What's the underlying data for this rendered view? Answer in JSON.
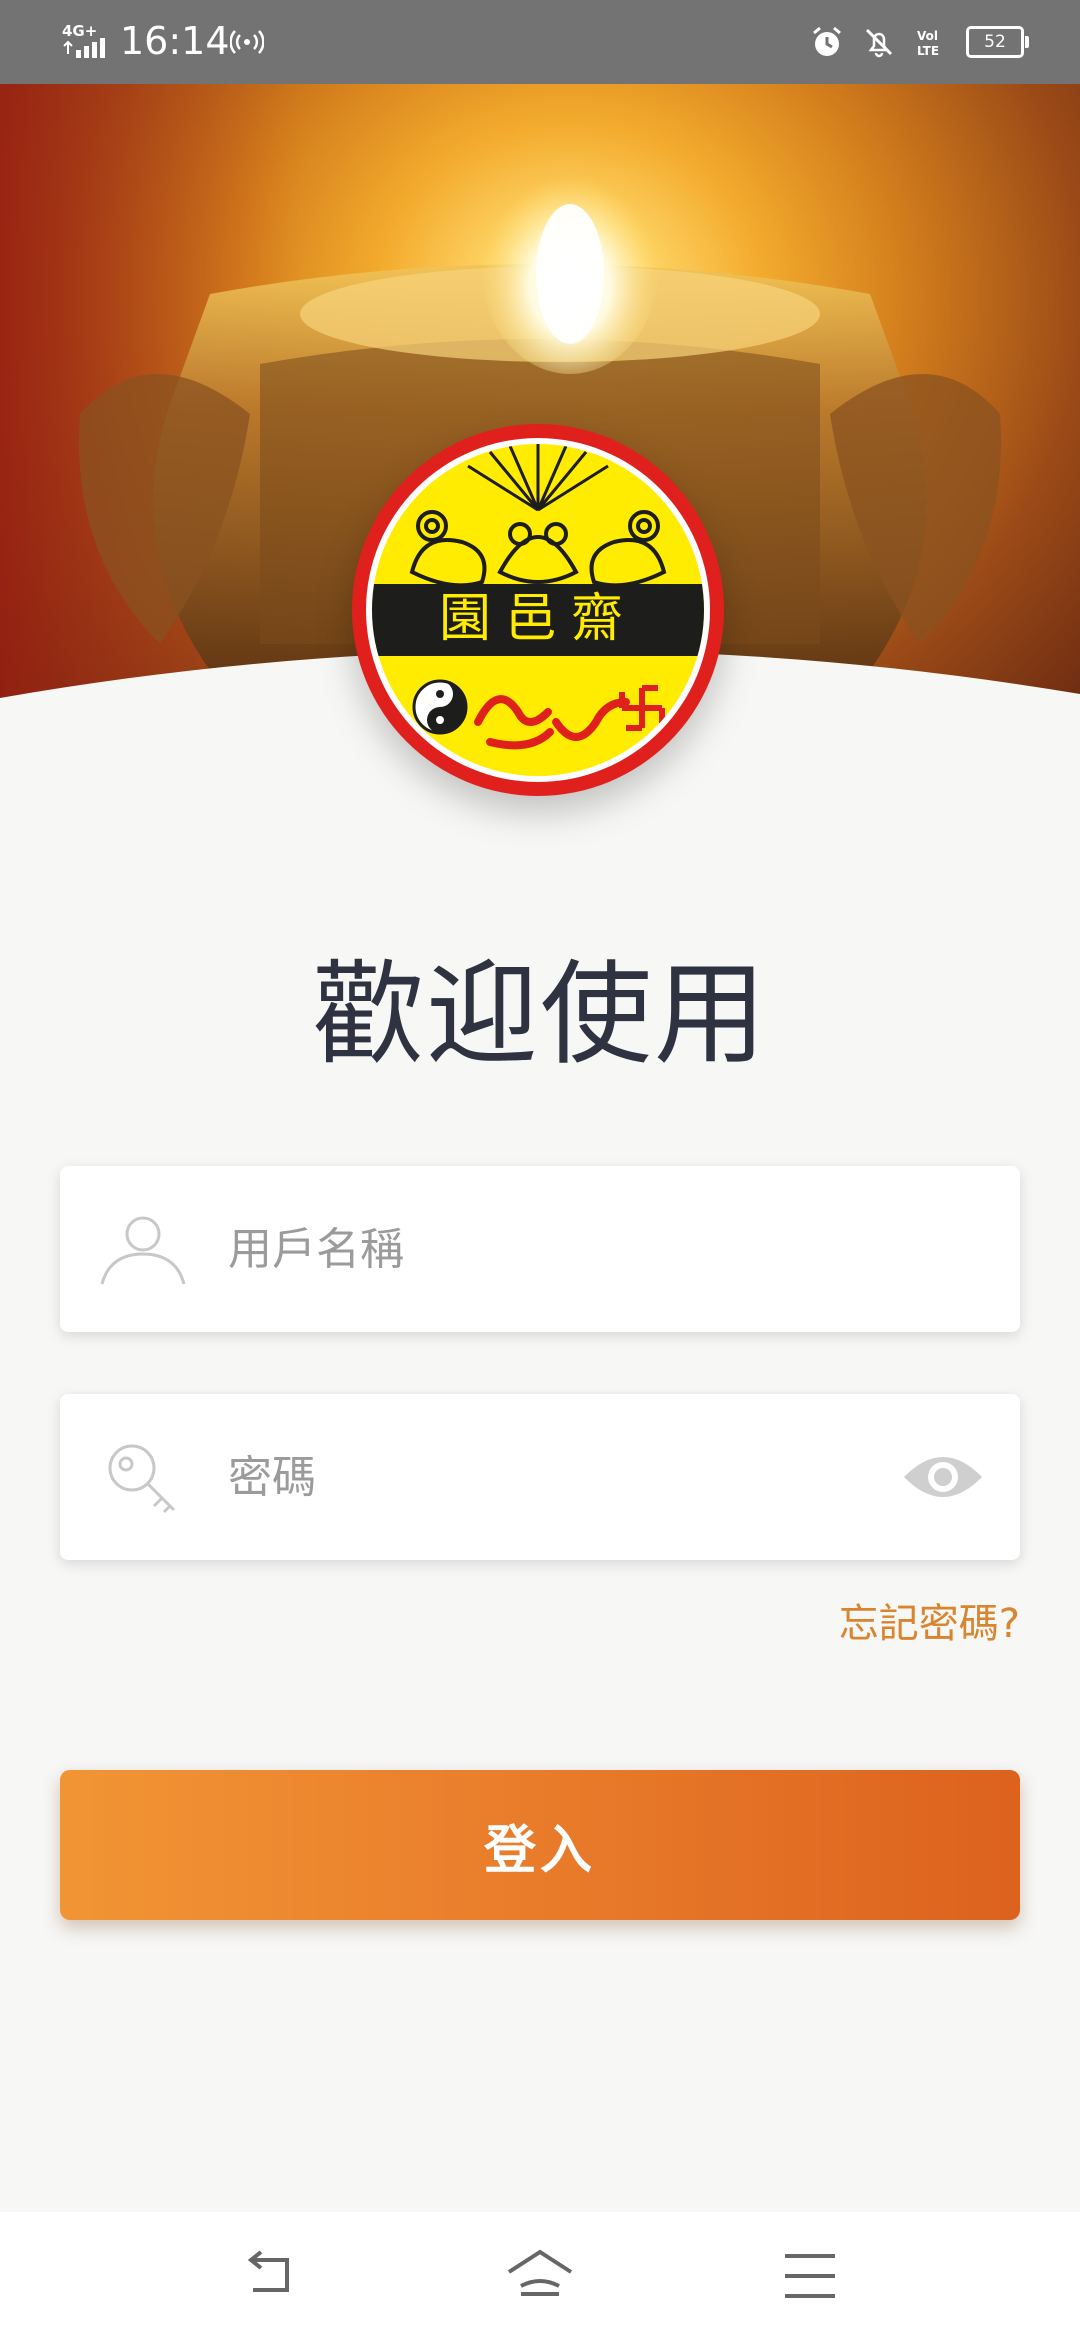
{
  "status_bar": {
    "network": "4G+",
    "time": "16:14",
    "battery": "52",
    "volte": "Vol LTE"
  },
  "logo": {
    "seal_text": "園邑齋"
  },
  "welcome": {
    "title": "歡迎使用"
  },
  "form": {
    "username": {
      "placeholder": "用戶名稱",
      "value": "",
      "icon": "person-icon"
    },
    "password": {
      "placeholder": "密碼",
      "value": "",
      "icon": "key-icon",
      "toggle_icon": "eye-icon"
    },
    "forgot_label": "忘記密碼?",
    "login_label": "登入"
  },
  "nav": {
    "back_icon": "back-icon",
    "home_icon": "home-icon",
    "menu_icon": "menu-icon"
  },
  "colors": {
    "accent": "#e8792a",
    "link": "#d9842e",
    "title": "#2f3240",
    "status_bar": "#737373",
    "seal_red": "#e0201c",
    "seal_yellow": "#ffec00"
  }
}
